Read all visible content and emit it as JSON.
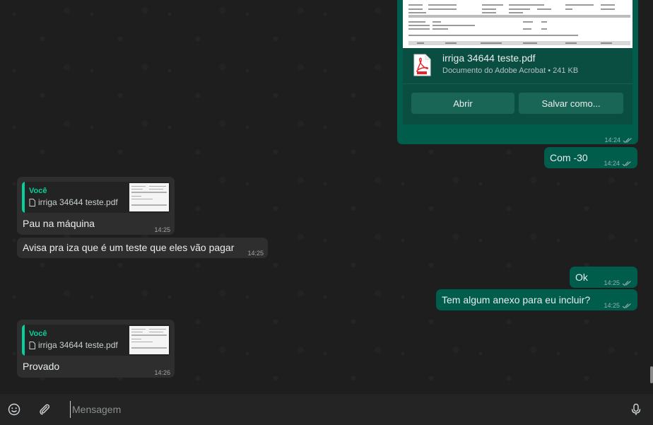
{
  "conversation": {
    "pdf_message": {
      "file_name": "irriga 34644 teste.pdf",
      "file_info": "Documento do Adobe Acrobat • 241 KB",
      "open_label": "Abrir",
      "save_label": "Salvar como...",
      "time": "14:24",
      "status_icon": "double-check-icon"
    },
    "messages": [
      {
        "direction": "outgoing",
        "text": "Com -30",
        "time": "14:24"
      },
      {
        "direction": "incoming",
        "reply_to": {
          "author": "Você",
          "file": "irriga 34644 teste.pdf"
        },
        "text": "Pau na máquina",
        "time": "14:25"
      },
      {
        "direction": "incoming",
        "text": "Avisa pra iza que é um teste que eles vão pagar",
        "time": "14:25"
      },
      {
        "direction": "outgoing",
        "text": "Ok",
        "time": "14:25"
      },
      {
        "direction": "outgoing",
        "text": "Tem algum anexo para eu incluir?",
        "time": "14:25"
      },
      {
        "direction": "incoming",
        "reply_to": {
          "author": "Você",
          "file": "irriga 34644 teste.pdf"
        },
        "text": "Provado",
        "time": "14:26"
      }
    ]
  },
  "composer": {
    "placeholder": "Mensagem",
    "emoji_icon": "emoji-icon",
    "attach_icon": "paperclip-icon",
    "mic_icon": "microphone-icon"
  },
  "colors": {
    "outgoing_bubble": "#005c4b",
    "incoming_bubble": "#2e2e2e",
    "accent": "#06cf9c",
    "background": "#1e1e1e"
  }
}
